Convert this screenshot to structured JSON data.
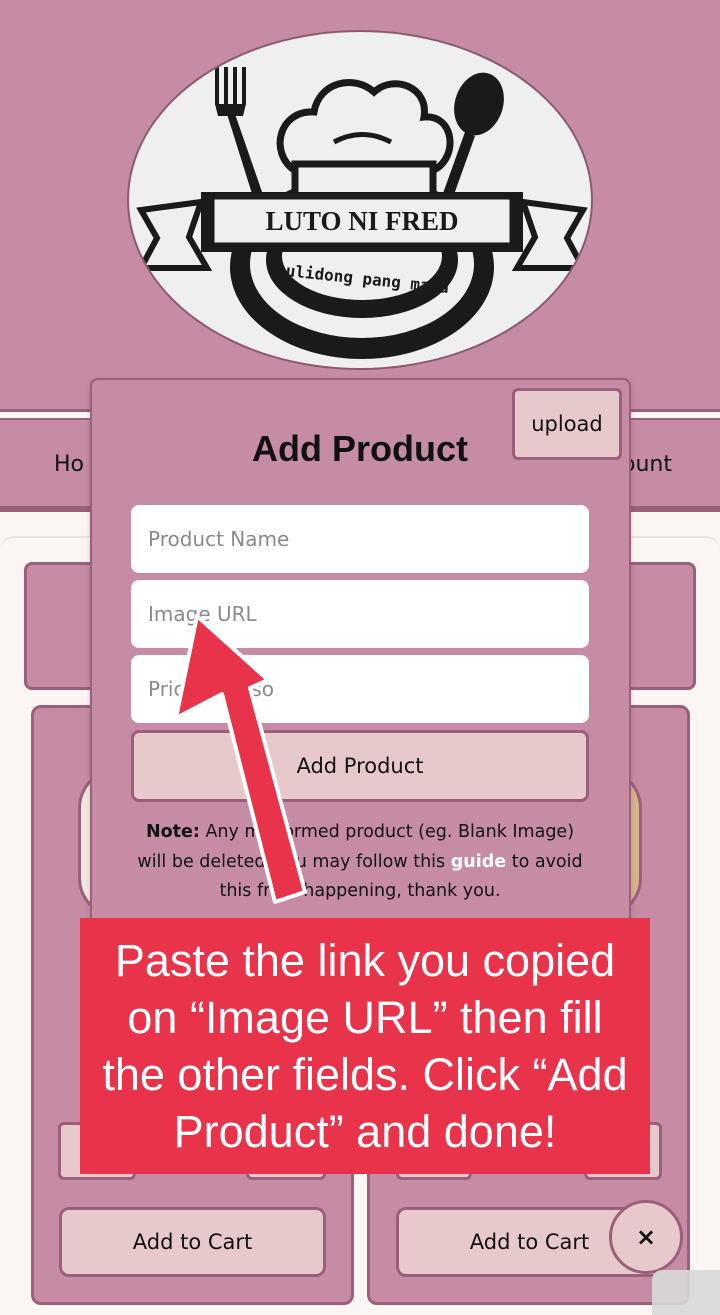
{
  "brand": {
    "name": "LUTO NI FRED",
    "tagline": "sulidong pang masa"
  },
  "nav": {
    "left_partial": "Ho",
    "right_partial": "ount"
  },
  "modal": {
    "upload_label": "upload",
    "title": "Add Product",
    "fields": {
      "product_name_placeholder": "Product Name",
      "image_url_placeholder": "Image URL",
      "price_placeholder": "Price in Peso"
    },
    "submit_label": "Add Product",
    "note": {
      "label": "Note:",
      "text_before_link": "Any malformed product (eg. Blank Image) will be deleted. You may follow this",
      "link_text": "guide",
      "text_after_link": "to avoid this from happening, thank you."
    }
  },
  "products": {
    "add_to_cart_label": "Add to Cart"
  },
  "tutorial": {
    "callout_text": "Paste the link you copied on “Image URL” then fill the other fields. Click “Add Product” and done!"
  },
  "fab": {
    "close_glyph": "×"
  },
  "colors": {
    "primary": "#c68ca5",
    "border": "#9a6079",
    "button": "#e7c9cc",
    "callout": "#e8334a",
    "background": "#fbf6f3"
  },
  "icons": [
    "fork-icon",
    "spoon-icon",
    "chef-hat-icon",
    "close-icon",
    "arrow-indicator"
  ]
}
